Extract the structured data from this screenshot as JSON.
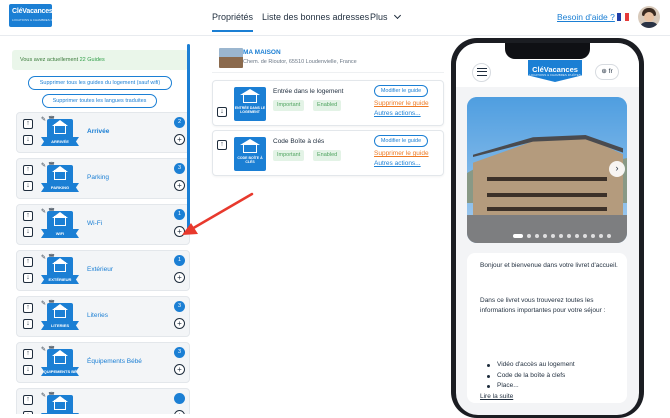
{
  "header": {
    "logo_title": "CléVacances",
    "logo_subtitle": "LOCATIONS & CHAMBRES D'HÔTES",
    "nav": [
      {
        "label": "Propriétés",
        "active": true
      },
      {
        "label": "Liste des bonnes adresses",
        "active": false
      },
      {
        "label": "Plus",
        "active": false
      }
    ],
    "help_link": "Besoin d'aide ?",
    "flag_colors": [
      "#1f3ea8",
      "#ffffff",
      "#e63a3a"
    ]
  },
  "left_panel": {
    "info_prefix": "Vous avez actuellement ",
    "info_count": "22 Guides",
    "btn_delete_guides": "Supprimer tous les guides du logement (sauf wifi)",
    "btn_delete_languages": "Supprimer toutes les langues traduites",
    "categories": [
      {
        "name": "Arrivée",
        "banner": "ARRIVÉE",
        "count": "2",
        "bold": true
      },
      {
        "name": "Parking",
        "banner": "PARKING",
        "count": "3",
        "bold": false
      },
      {
        "name": "Wi-Fi",
        "banner": "WIFI",
        "count": "1",
        "bold": false
      },
      {
        "name": "Extérieur",
        "banner": "EXTÉRIEUR",
        "count": "1",
        "bold": false
      },
      {
        "name": "Literies",
        "banner": "LITERIES",
        "count": "3",
        "bold": false
      },
      {
        "name": "Équipements Bébé",
        "banner": "ÉQUIPEMENTS BÉBÉ",
        "count": "3",
        "bold": false
      },
      {
        "name": "",
        "banner": "",
        "count": "",
        "bold": false
      }
    ]
  },
  "property": {
    "name": "MA MAISON",
    "address": "Chem. de Rioutor, 65510 Loudenvielle, France"
  },
  "guides": [
    {
      "title": "Entrée dans le logement",
      "icon_label": "ENTRÉE DANS LE LOGEMENT",
      "tags": [
        "Important",
        "Enabled"
      ],
      "edit": "Modifier le guide",
      "delete": "Supprimer le guide",
      "actions": "Autres actions..."
    },
    {
      "title": "Code Boîte à clés",
      "icon_label": "CODE BOÎTE À CLÉS",
      "tags": [
        "Important",
        "Enabled"
      ],
      "edit": "Modifier le guide",
      "delete": "Supprimer le guide",
      "actions": "Autres actions..."
    }
  ],
  "phone": {
    "logo_title": "CléVacances",
    "logo_subtitle": "LOCATIONS & CHAMBRES D'HÔTES",
    "lang": "fr",
    "welcome": "Bonjour et bienvenue dans votre livret d'accueil.",
    "intro": "Dans ce livret vous trouverez toutes les informations importantes pour votre séjour :",
    "bullets": [
      "Vidéo d'accès au logement",
      "Code de la boîte à clefs",
      "Place..."
    ],
    "read_more": "Lire la suite",
    "carousel_total": 12,
    "carousel_active": 1
  },
  "colors": {
    "accent": "#1b7fd4",
    "delete_link": "#ee7b24",
    "tag_bg": "#e3f3e6",
    "tag_text": "#4ea35f",
    "annotation_arrow": "#e8392d"
  }
}
